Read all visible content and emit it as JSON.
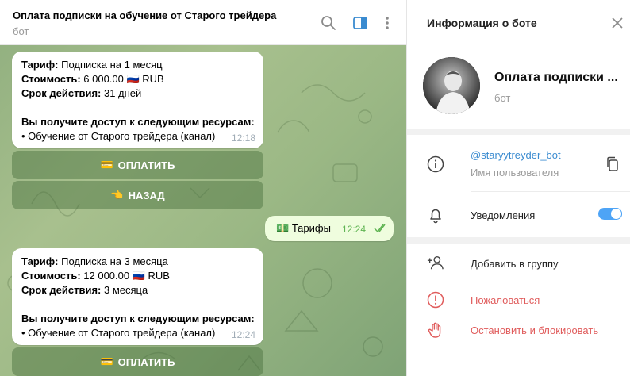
{
  "chat": {
    "title": "Оплата подписки на обучение от Старого трейдера",
    "subtitle": "бот"
  },
  "messages": [
    {
      "tariff_label": "Тариф:",
      "tariff_value": " Подписка на 1 месяц",
      "cost_label": "Стоимость:",
      "cost_value": " 6 000.00 🇷🇺 RUB",
      "duration_label": "Срок действия:",
      "duration_value": " 31 дней",
      "access_heading": "Вы получите доступ к следующим ресурсам:",
      "resource": "• Обучение от Старого трейдера (канал)",
      "time": "12:18"
    },
    {
      "tariff_label": "Тариф:",
      "tariff_value": " Подписка на 3 месяца",
      "cost_label": "Стоимость:",
      "cost_value": " 12 000.00 🇷🇺 RUB",
      "duration_label": "Срок действия:",
      "duration_value": " 3 месяца",
      "access_heading": "Вы получите доступ к следующим ресурсам:",
      "resource": "• Обучение от Старого трейдера (канал)",
      "time": "12:24"
    }
  ],
  "buttons": {
    "pay_icon": "💳",
    "pay_label": "ОПЛАТИТЬ",
    "back_icon": "👈",
    "back_label": "НАЗАД"
  },
  "outgoing": {
    "icon": "💵",
    "text": "Тарифы",
    "time": "12:24"
  },
  "info": {
    "title": "Информация о боте",
    "bot_name": "Оплата подписки ...",
    "bot_sub": "бот",
    "username": "@staryytreyder_bot",
    "username_caption": "Имя пользователя",
    "notifications_label": "Уведомления",
    "notifications_on": true,
    "add_to_group": "Добавить в группу",
    "report": "Пожаловаться",
    "block": "Остановить и блокировать"
  },
  "colors": {
    "accent": "#3a8bd0",
    "danger": "#e05c5c",
    "toggle": "#4ea4f6",
    "outgoing_bubble": "#effdde",
    "outgoing_time": "#5fb452"
  },
  "icons": {
    "search": "search-icon",
    "sidebar": "sidebar-toggle-icon",
    "more": "more-vertical-icon",
    "close": "close-icon",
    "info": "info-circle-icon",
    "copy": "copy-icon",
    "bell": "bell-icon",
    "add_user": "add-user-icon",
    "report": "report-icon",
    "block": "hand-stop-icon",
    "read": "double-check-icon"
  }
}
